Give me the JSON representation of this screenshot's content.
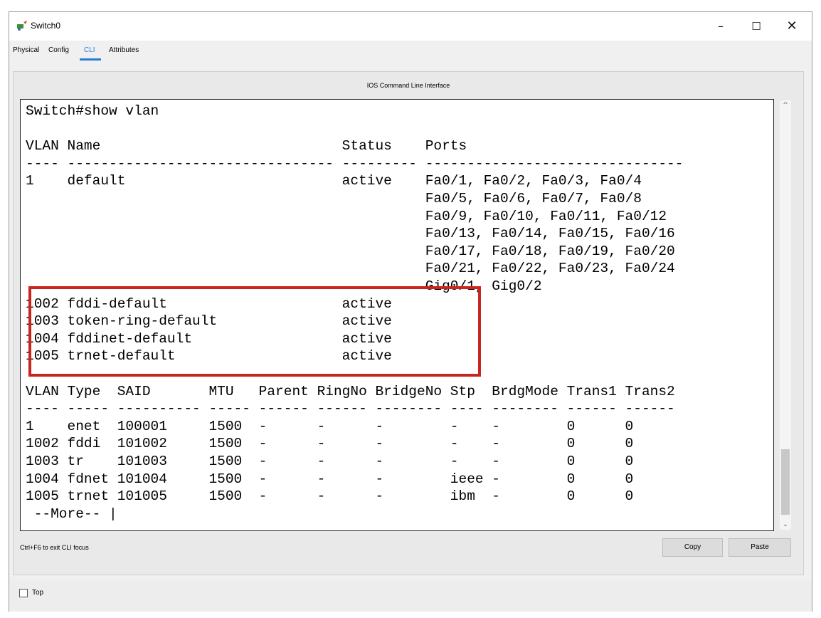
{
  "window": {
    "title": "Switch0"
  },
  "tabs": [
    {
      "label": "Physical",
      "active": false
    },
    {
      "label": "Config",
      "active": false
    },
    {
      "label": "CLI",
      "active": true
    },
    {
      "label": "Attributes",
      "active": false
    }
  ],
  "panel": {
    "title": "IOS Command Line Interface"
  },
  "terminal": {
    "lines": [
      "Switch#show vlan",
      "",
      "VLAN Name                             Status    Ports",
      "---- -------------------------------- --------- -------------------------------",
      "1    default                          active    Fa0/1, Fa0/2, Fa0/3, Fa0/4",
      "                                                Fa0/5, Fa0/6, Fa0/7, Fa0/8",
      "                                                Fa0/9, Fa0/10, Fa0/11, Fa0/12",
      "                                                Fa0/13, Fa0/14, Fa0/15, Fa0/16",
      "                                                Fa0/17, Fa0/18, Fa0/19, Fa0/20",
      "                                                Fa0/21, Fa0/22, Fa0/23, Fa0/24",
      "                                                Gig0/1, Gig0/2",
      "1002 fddi-default                     active",
      "1003 token-ring-default               active",
      "1004 fddinet-default                  active",
      "1005 trnet-default                    active",
      "",
      "VLAN Type  SAID       MTU   Parent RingNo BridgeNo Stp  BrdgMode Trans1 Trans2",
      "---- ----- ---------- ----- ------ ------ -------- ---- -------- ------ ------",
      "1    enet  100001     1500  -      -      -        -    -        0      0",
      "1002 fddi  101002     1500  -      -      -        -    -        0      0",
      "1003 tr    101003     1500  -      -      -        -    -        0      0",
      "1004 fdnet 101004     1500  -      -      -        ieee -        0      0",
      "1005 trnet 101005     1500  -      -      -        ibm  -        0      0",
      " --More-- |"
    ]
  },
  "footer": {
    "hint": "Ctrl+F6 to exit CLI focus",
    "copy_label": "Copy",
    "paste_label": "Paste",
    "top_label": "Top"
  },
  "colors": {
    "active_tab": "#2a7bd6",
    "highlight_box": "#c9241d"
  }
}
